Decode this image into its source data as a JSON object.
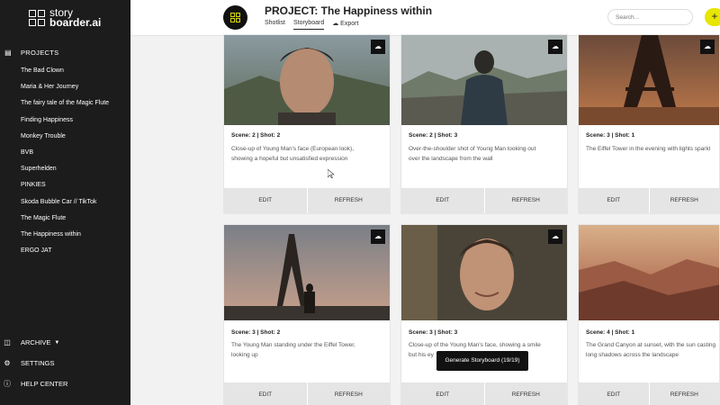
{
  "brand": {
    "name_prefix": "story",
    "name_main": "boarder",
    "name_suffix": ".ai"
  },
  "sidebar": {
    "projects_label": "PROJECTS",
    "projects": [
      "The Bad Clown",
      "Maria & Her Journey",
      "The fairy tale of the Magic Flute",
      "Finding Happiness",
      "Monkey Trouble",
      "BVB",
      "Superhelden",
      "PINKIES",
      "Skoda Bubble Car // TikTok",
      "The Magic Flute",
      "The Happiness within",
      "ERGO JAT"
    ],
    "archive_label": "ARCHIVE",
    "settings_label": "SETTINGS",
    "help_label": "HELP CENTER"
  },
  "header": {
    "title": "PROJECT: The Happiness within",
    "tabs": [
      "Shotlist",
      "Storyboard",
      "Export"
    ],
    "active_tab": "Storyboard",
    "search_placeholder": "Search...",
    "add_label": "+"
  },
  "cards": [
    {
      "meta": "Scene: 2 | Shot: 2",
      "desc": "Close-up of Young Man's face (European look),\nshowing a hopeful but unsatisfied expression",
      "edit": "EDIT",
      "refresh": "REFRESH"
    },
    {
      "meta": "Scene: 2 | Shot: 3",
      "desc": "Over-the-shoulder shot of Young Man looking out\nover the landscape from the wall",
      "edit": "EDIT",
      "refresh": "REFRESH"
    },
    {
      "meta": "Scene: 3 | Shot: 1",
      "desc": "The Eiffel Tower in the evening with lights sparkl",
      "edit": "EDIT",
      "refresh": "REFRESH"
    },
    {
      "meta": "Scene: 3 | Shot: 2",
      "desc": "The Young Man standing under the Eiffel Tower,\nlooking up",
      "edit": "EDIT",
      "refresh": "REFRESH"
    },
    {
      "meta": "Scene: 3 | Shot: 3",
      "desc": "Close-up of the Young Man's face, showing a smile\nbut his ey",
      "edit": "EDIT",
      "refresh": "REFRESH"
    },
    {
      "meta": "Scene: 4 | Shot: 1",
      "desc": "The Grand Canyon at sunset, with the sun casting\nlong shadows across the landscape",
      "edit": "EDIT",
      "refresh": "REFRESH"
    }
  ],
  "tooltip": "Generate Storyboard (19/19)",
  "colors": {
    "sidebar_bg": "#1c1c1c",
    "accent": "#e6e600",
    "button_bg": "#e5e5e5"
  },
  "icons": {
    "card_export": "cloud-upload-icon",
    "archive": "archive-icon",
    "settings": "gear-icon",
    "help": "info-icon",
    "projects": "film-icon"
  }
}
